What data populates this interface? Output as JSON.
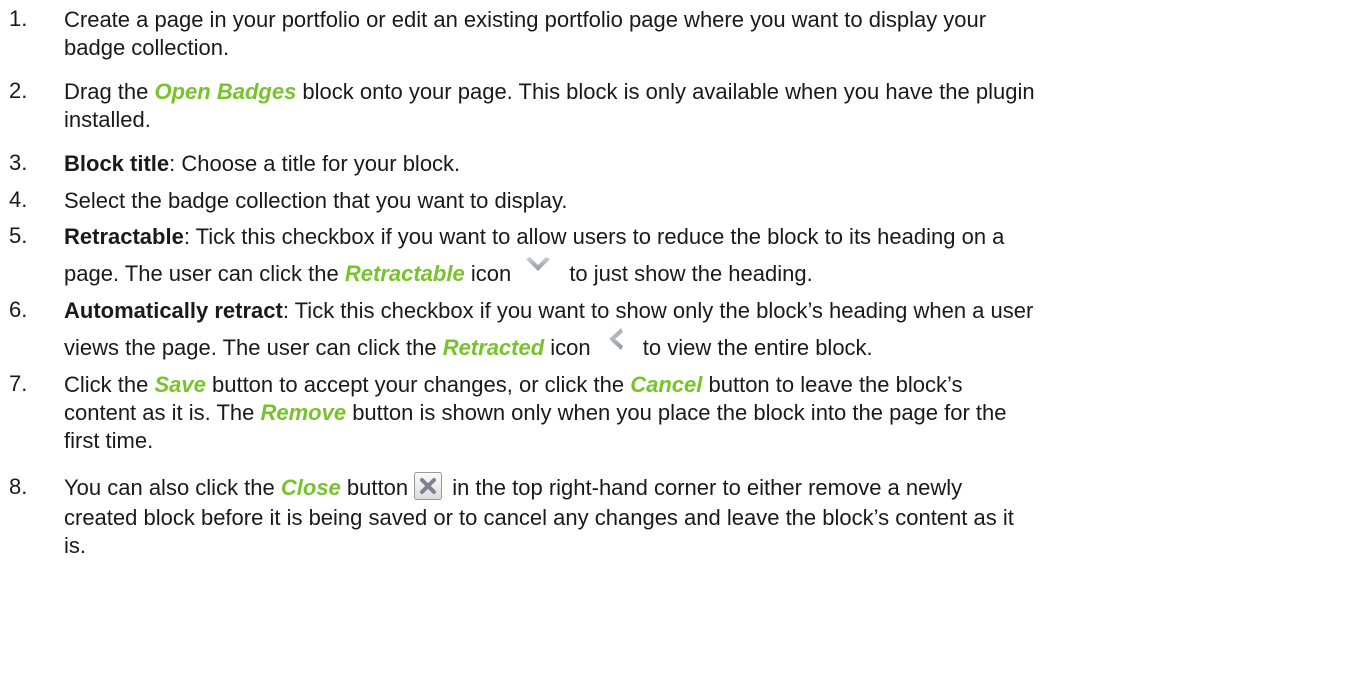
{
  "steps": [
    {
      "num": "1.",
      "lines": [
        "Create a page in your portfolio or edit an existing portfolio page where you want to display your",
        "badge collection."
      ]
    },
    {
      "num": "2.",
      "l1_pre": "Drag the ",
      "kw": "Open Badges",
      "l1_post": " block onto your page. This block is only available when you have the plugin",
      "l2": "installed."
    },
    {
      "num": "3.",
      "bold": "Block title",
      "rest": ": Choose a title for your block."
    },
    {
      "num": "4.",
      "text": "Select the badge collection that you want to display."
    },
    {
      "num": "5.",
      "bold": "Retractable",
      "rest": ": Tick this checkbox if you want to allow users to reduce the block to its heading on a",
      "l2_pre": "page. The user can click the ",
      "kw": "Retractable",
      "l2_mid": " icon",
      "icon": "chevron-down-icon",
      "l2_post": " to just show the heading."
    },
    {
      "num": "6.",
      "bold": "Automatically retract",
      "rest": ": Tick this checkbox if you want to show only the block’s heading when a user",
      "l2_pre": "views the page. The user can click the ",
      "kw": "Retracted",
      "l2_mid": " icon",
      "icon": "chevron-left-icon",
      "l2_post": " to view the entire block."
    },
    {
      "num": "7.",
      "l1_pre": "Click the ",
      "kw1": "Save",
      "l1_mid": " button to accept your changes, or click the ",
      "kw2": "Cancel",
      "l1_post": " button to leave the block’s",
      "l2_pre": "content as it is. The ",
      "kw3": "Remove",
      "l2_post": " button is shown only when you place the block into the page for the",
      "l3": "first time."
    },
    {
      "num": "8.",
      "l1_pre": "You can also click the ",
      "kw": "Close",
      "l1_mid": " button",
      "icon": "close-icon",
      "l1_post": " in the top right-hand corner to either remove a newly",
      "l2": "created block before it is being saved or to cancel any changes and leave the block’s content as it",
      "l3": "is."
    }
  ],
  "colors": {
    "keyword": "#78c32a",
    "text": "#1a1a1a"
  }
}
